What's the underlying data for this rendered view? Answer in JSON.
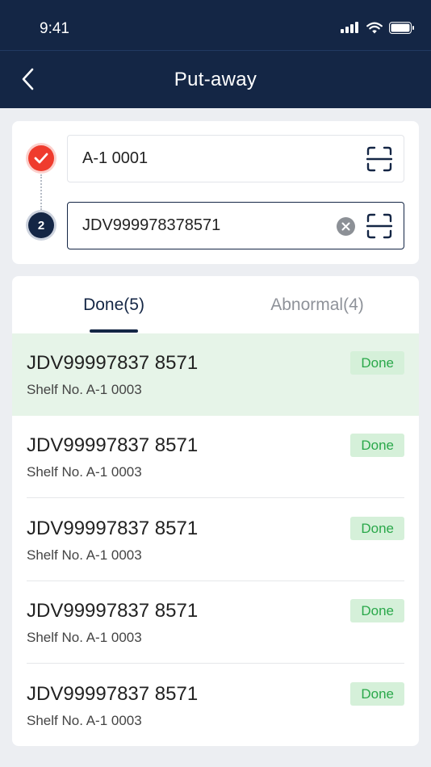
{
  "status_bar": {
    "time": "9:41"
  },
  "nav": {
    "title": "Put-away"
  },
  "steps": {
    "shelf_value": "A-1 0001",
    "step2_number": "2",
    "waybill_value": "JDV999978378571"
  },
  "tabs": [
    {
      "label": "Done(5)",
      "active": true
    },
    {
      "label": "Abnormal(4)",
      "active": false
    }
  ],
  "items": [
    {
      "code": "JDV99997837 8571",
      "shelf": "Shelf No. A-1 0003",
      "status": "Done",
      "selected": true
    },
    {
      "code": "JDV99997837 8571",
      "shelf": "Shelf No. A-1 0003",
      "status": "Done",
      "selected": false
    },
    {
      "code": "JDV99997837 8571",
      "shelf": "Shelf No. A-1 0003",
      "status": "Done",
      "selected": false
    },
    {
      "code": "JDV99997837 8571",
      "shelf": "Shelf No. A-1 0003",
      "status": "Done",
      "selected": false
    },
    {
      "code": "JDV99997837 8571",
      "shelf": "Shelf No. A-1 0003",
      "status": "Done",
      "selected": false
    }
  ],
  "colors": {
    "header_bg": "#142645",
    "accent_red": "#ef3b2d",
    "done_green": "#2aa84a",
    "done_badge_bg": "#d5f0d9",
    "selected_row_bg": "#e6f4e8"
  },
  "icons": {
    "back": "chevron-left-icon",
    "signal": "signal-icon",
    "wifi": "wifi-icon",
    "battery": "battery-icon",
    "check": "check-icon",
    "scan": "scan-icon",
    "clear": "clear-icon"
  }
}
